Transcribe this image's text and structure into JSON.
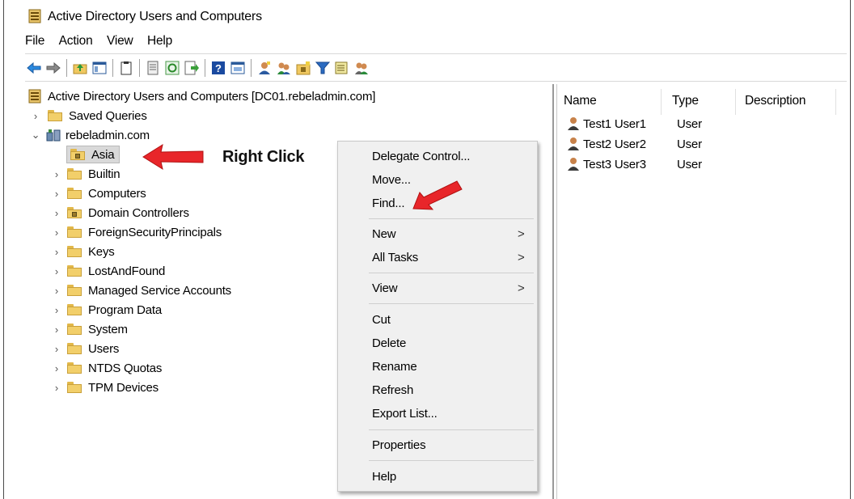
{
  "window": {
    "title": "Active Directory Users and Computers"
  },
  "menubar": [
    "File",
    "Action",
    "View",
    "Help"
  ],
  "toolbar_icons": [
    "back-icon",
    "forward-icon",
    "up-folder-icon",
    "show-hide-console-tree-icon",
    "clipboard-icon",
    "export-list-icon",
    "refresh-icon",
    "export-icon",
    "help-icon",
    "properties-icon",
    "new-user-icon",
    "new-group-icon",
    "new-ou-icon",
    "filter-icon",
    "find-icon",
    "add-to-group-icon"
  ],
  "tree": {
    "root": "Active Directory Users and Computers [DC01.rebeladmin.com]",
    "saved_queries": "Saved Queries",
    "domain": "rebeladmin.com",
    "items": [
      {
        "label": "Asia"
      },
      {
        "label": "Builtin"
      },
      {
        "label": "Computers"
      },
      {
        "label": "Domain Controllers"
      },
      {
        "label": "ForeignSecurityPrincipals"
      },
      {
        "label": "Keys"
      },
      {
        "label": "LostAndFound"
      },
      {
        "label": "Managed Service Accounts"
      },
      {
        "label": "Program Data"
      },
      {
        "label": "System"
      },
      {
        "label": "Users"
      },
      {
        "label": "NTDS Quotas"
      },
      {
        "label": "TPM Devices"
      }
    ]
  },
  "list": {
    "columns": [
      "Name",
      "Type",
      "Description"
    ],
    "rows": [
      {
        "name": "Test1 User1",
        "type": "User"
      },
      {
        "name": "Test2 User2",
        "type": "User"
      },
      {
        "name": "Test3 User3",
        "type": "User"
      }
    ]
  },
  "context_menu": {
    "items": [
      "Delegate Control...",
      "Move...",
      "Find...",
      "New",
      "All Tasks",
      "View",
      "Cut",
      "Delete",
      "Rename",
      "Refresh",
      "Export List...",
      "Properties",
      "Help"
    ],
    "submenu_arrow": ">"
  },
  "annotation": {
    "text": "Right Click",
    "arrow_color": "#e8262a"
  }
}
